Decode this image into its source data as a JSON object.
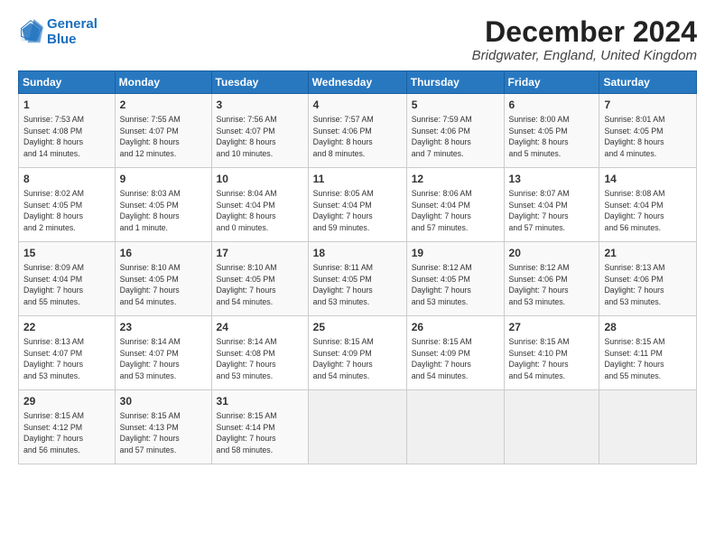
{
  "logo": {
    "line1": "General",
    "line2": "Blue"
  },
  "title": "December 2024",
  "subtitle": "Bridgwater, England, United Kingdom",
  "days_of_week": [
    "Sunday",
    "Monday",
    "Tuesday",
    "Wednesday",
    "Thursday",
    "Friday",
    "Saturday"
  ],
  "weeks": [
    [
      {
        "day": "1",
        "info": "Sunrise: 7:53 AM\nSunset: 4:08 PM\nDaylight: 8 hours\nand 14 minutes."
      },
      {
        "day": "2",
        "info": "Sunrise: 7:55 AM\nSunset: 4:07 PM\nDaylight: 8 hours\nand 12 minutes."
      },
      {
        "day": "3",
        "info": "Sunrise: 7:56 AM\nSunset: 4:07 PM\nDaylight: 8 hours\nand 10 minutes."
      },
      {
        "day": "4",
        "info": "Sunrise: 7:57 AM\nSunset: 4:06 PM\nDaylight: 8 hours\nand 8 minutes."
      },
      {
        "day": "5",
        "info": "Sunrise: 7:59 AM\nSunset: 4:06 PM\nDaylight: 8 hours\nand 7 minutes."
      },
      {
        "day": "6",
        "info": "Sunrise: 8:00 AM\nSunset: 4:05 PM\nDaylight: 8 hours\nand 5 minutes."
      },
      {
        "day": "7",
        "info": "Sunrise: 8:01 AM\nSunset: 4:05 PM\nDaylight: 8 hours\nand 4 minutes."
      }
    ],
    [
      {
        "day": "8",
        "info": "Sunrise: 8:02 AM\nSunset: 4:05 PM\nDaylight: 8 hours\nand 2 minutes."
      },
      {
        "day": "9",
        "info": "Sunrise: 8:03 AM\nSunset: 4:05 PM\nDaylight: 8 hours\nand 1 minute."
      },
      {
        "day": "10",
        "info": "Sunrise: 8:04 AM\nSunset: 4:04 PM\nDaylight: 8 hours\nand 0 minutes."
      },
      {
        "day": "11",
        "info": "Sunrise: 8:05 AM\nSunset: 4:04 PM\nDaylight: 7 hours\nand 59 minutes."
      },
      {
        "day": "12",
        "info": "Sunrise: 8:06 AM\nSunset: 4:04 PM\nDaylight: 7 hours\nand 57 minutes."
      },
      {
        "day": "13",
        "info": "Sunrise: 8:07 AM\nSunset: 4:04 PM\nDaylight: 7 hours\nand 57 minutes."
      },
      {
        "day": "14",
        "info": "Sunrise: 8:08 AM\nSunset: 4:04 PM\nDaylight: 7 hours\nand 56 minutes."
      }
    ],
    [
      {
        "day": "15",
        "info": "Sunrise: 8:09 AM\nSunset: 4:04 PM\nDaylight: 7 hours\nand 55 minutes."
      },
      {
        "day": "16",
        "info": "Sunrise: 8:10 AM\nSunset: 4:05 PM\nDaylight: 7 hours\nand 54 minutes."
      },
      {
        "day": "17",
        "info": "Sunrise: 8:10 AM\nSunset: 4:05 PM\nDaylight: 7 hours\nand 54 minutes."
      },
      {
        "day": "18",
        "info": "Sunrise: 8:11 AM\nSunset: 4:05 PM\nDaylight: 7 hours\nand 53 minutes."
      },
      {
        "day": "19",
        "info": "Sunrise: 8:12 AM\nSunset: 4:05 PM\nDaylight: 7 hours\nand 53 minutes."
      },
      {
        "day": "20",
        "info": "Sunrise: 8:12 AM\nSunset: 4:06 PM\nDaylight: 7 hours\nand 53 minutes."
      },
      {
        "day": "21",
        "info": "Sunrise: 8:13 AM\nSunset: 4:06 PM\nDaylight: 7 hours\nand 53 minutes."
      }
    ],
    [
      {
        "day": "22",
        "info": "Sunrise: 8:13 AM\nSunset: 4:07 PM\nDaylight: 7 hours\nand 53 minutes."
      },
      {
        "day": "23",
        "info": "Sunrise: 8:14 AM\nSunset: 4:07 PM\nDaylight: 7 hours\nand 53 minutes."
      },
      {
        "day": "24",
        "info": "Sunrise: 8:14 AM\nSunset: 4:08 PM\nDaylight: 7 hours\nand 53 minutes."
      },
      {
        "day": "25",
        "info": "Sunrise: 8:15 AM\nSunset: 4:09 PM\nDaylight: 7 hours\nand 54 minutes."
      },
      {
        "day": "26",
        "info": "Sunrise: 8:15 AM\nSunset: 4:09 PM\nDaylight: 7 hours\nand 54 minutes."
      },
      {
        "day": "27",
        "info": "Sunrise: 8:15 AM\nSunset: 4:10 PM\nDaylight: 7 hours\nand 54 minutes."
      },
      {
        "day": "28",
        "info": "Sunrise: 8:15 AM\nSunset: 4:11 PM\nDaylight: 7 hours\nand 55 minutes."
      }
    ],
    [
      {
        "day": "29",
        "info": "Sunrise: 8:15 AM\nSunset: 4:12 PM\nDaylight: 7 hours\nand 56 minutes."
      },
      {
        "day": "30",
        "info": "Sunrise: 8:15 AM\nSunset: 4:13 PM\nDaylight: 7 hours\nand 57 minutes."
      },
      {
        "day": "31",
        "info": "Sunrise: 8:15 AM\nSunset: 4:14 PM\nDaylight: 7 hours\nand 58 minutes."
      },
      {
        "day": "",
        "info": ""
      },
      {
        "day": "",
        "info": ""
      },
      {
        "day": "",
        "info": ""
      },
      {
        "day": "",
        "info": ""
      }
    ]
  ]
}
